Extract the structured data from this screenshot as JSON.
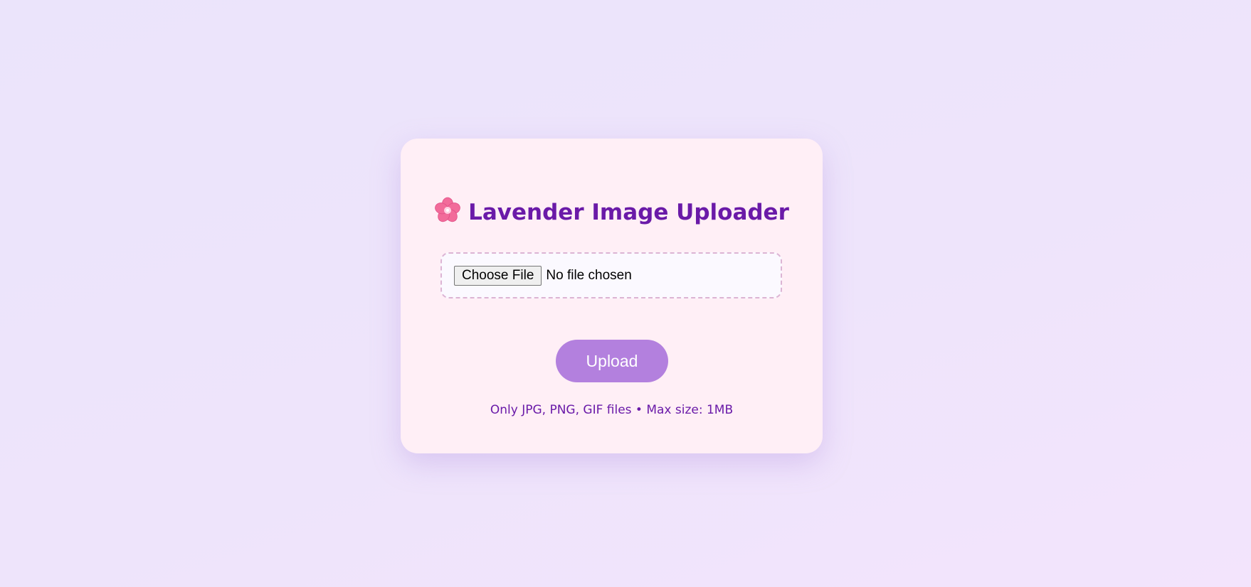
{
  "uploader": {
    "title": "Lavender Image Uploader",
    "title_icon": "cherry-blossom-icon",
    "file_input": {
      "button_label": "Choose File",
      "status_text": "No file chosen"
    },
    "upload_label": "Upload",
    "hint_text": "Only JPG, PNG, GIF files • Max size: 1MB"
  },
  "colors": {
    "background": "#ece4fb",
    "card": "#ffeff6",
    "title": "#6a1aa8",
    "upload_button": "#b380de",
    "dropzone_border": "#dcb4d4",
    "flower": "#f26b9a"
  }
}
